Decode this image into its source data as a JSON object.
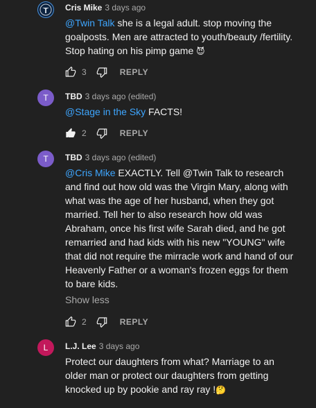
{
  "comments": [
    {
      "author": "Cris Mike",
      "time": "3 days ago",
      "mention": "@Twin Talk",
      "text": " she is a legal adult. stop moving the goalposts. Men are attracted to youth/beauty /fertility. Stop hating on his pimp game ",
      "emoji": "😈",
      "likes": "3",
      "reply": "REPLY",
      "avatar_icon": "titans-logo-icon"
    },
    {
      "author": "TBD",
      "time": "3 days ago (edited)",
      "mention": "@Stage in the Sky",
      "text": "  FACTS!",
      "likes": "2",
      "reply": "REPLY",
      "avatar_letter": "T"
    },
    {
      "author": "TBD",
      "time": "3 days ago (edited)",
      "mention": "@Cris Mike",
      "text": "  EXACTLY. Tell @Twin Talk to research and find out how old was the Virgin Mary, along with what was the age of her husband, when they got married. Tell her to also research how old was Abraham, once his first wife Sarah died, and he got remarried and had kids with his new \"YOUNG\" wife that did not require the mirracle work and hand of our Heavenly Father or a woman's frozen eggs for them to bare kids.",
      "show_less": "Show less",
      "likes": "2",
      "reply": "REPLY",
      "avatar_letter": "T"
    },
    {
      "author": "L.J. Lee",
      "time": "3 days ago",
      "text": "Protect our daughters from what? Marriage to an older man or protect our daughters from getting knocked up by pookie and ray ray !",
      "emoji": "🤔",
      "avatar_letter": "L"
    }
  ],
  "colors": {
    "background": "#212121",
    "mention": "#3ea6ff",
    "secondary_text": "#aaaaaa",
    "avatar_purple": "#7b5cc9",
    "avatar_pink": "#c2185b"
  }
}
